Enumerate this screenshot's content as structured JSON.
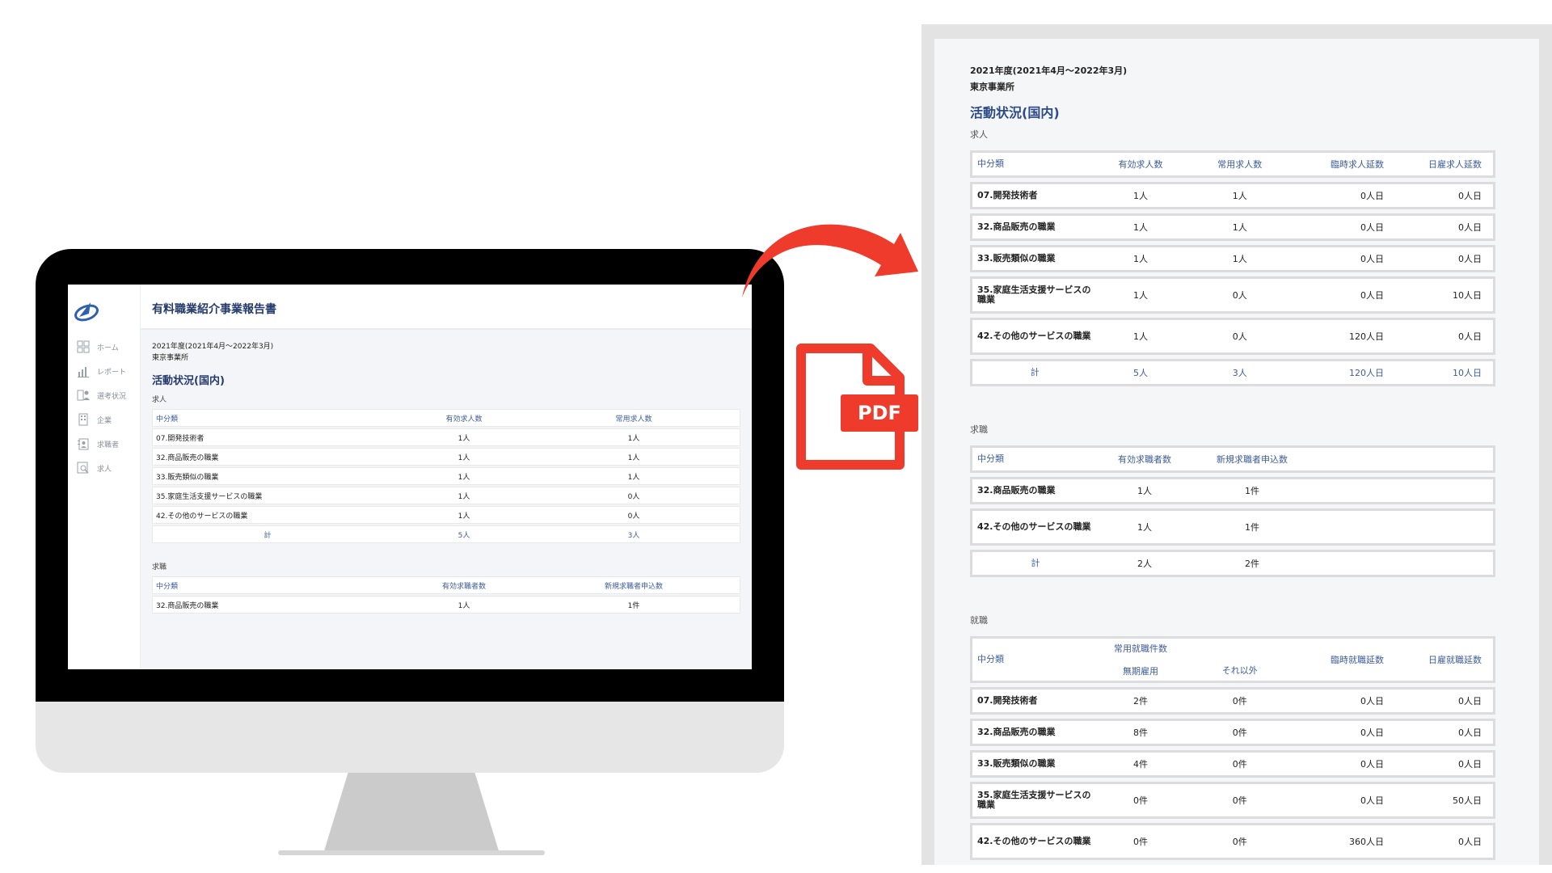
{
  "monitor": {
    "header_title": "有料職業紹介事業報告書",
    "sidebar": {
      "items": [
        {
          "label": "ホーム",
          "icon": "dashboard-icon"
        },
        {
          "label": "レポート",
          "icon": "bar-chart-icon"
        },
        {
          "label": "選考状況",
          "icon": "selection-icon"
        },
        {
          "label": "企業",
          "icon": "building-icon"
        },
        {
          "label": "求職者",
          "icon": "user-list-icon"
        },
        {
          "label": "求人",
          "icon": "job-search-icon"
        }
      ]
    },
    "period": "2021年度(2021年4月〜2022年3月)",
    "office": "東京事業所",
    "section_title": "活動状況(国内)",
    "jobs_label": "求人",
    "jobs_headers": [
      "中分類",
      "有効求人数",
      "常用求人数"
    ],
    "jobs_rows": [
      [
        "07.開発技術者",
        "1人",
        "1人"
      ],
      [
        "32.商品販売の職業",
        "1人",
        "1人"
      ],
      [
        "33.販売類似の職業",
        "1人",
        "1人"
      ],
      [
        "35.家庭生活支援サービスの職業",
        "1人",
        "0人"
      ],
      [
        "42.その他のサービスの職業",
        "1人",
        "0人"
      ]
    ],
    "jobs_total": [
      "計",
      "5人",
      "3人"
    ],
    "seekers_label": "求職",
    "seekers_headers": [
      "中分類",
      "有効求職者数",
      "新規求職者申込数"
    ],
    "seekers_rows": [
      [
        "32.商品販売の職業",
        "1人",
        "1件"
      ]
    ]
  },
  "pdf_badge": "PDF",
  "doc": {
    "period": "2021年度(2021年4月〜2022年3月)",
    "office": "東京事業所",
    "section_title": "活動状況(国内)",
    "jobs": {
      "label": "求人",
      "headers": [
        "中分類",
        "有効求人数",
        "常用求人数",
        "臨時求人延数",
        "日雇求人延数"
      ],
      "rows": [
        [
          "07.開発技術者",
          "1人",
          "1人",
          "0人日",
          "0人日"
        ],
        [
          "32.商品販売の職業",
          "1人",
          "1人",
          "0人日",
          "0人日"
        ],
        [
          "33.販売類似の職業",
          "1人",
          "1人",
          "0人日",
          "0人日"
        ],
        [
          "35.家庭生活支援サービスの職業",
          "1人",
          "0人",
          "0人日",
          "10人日"
        ],
        [
          "42.その他のサービスの職業",
          "1人",
          "0人",
          "120人日",
          "0人日"
        ]
      ],
      "total": [
        "計",
        "5人",
        "3人",
        "120人日",
        "10人日"
      ]
    },
    "seekers": {
      "label": "求職",
      "headers": [
        "中分類",
        "有効求職者数",
        "新規求職者申込数"
      ],
      "rows": [
        [
          "32.商品販売の職業",
          "1人",
          "1件"
        ],
        [
          "42.その他のサービスの職業",
          "1人",
          "1件"
        ]
      ],
      "total": [
        "計",
        "2人",
        "2件"
      ]
    },
    "placements": {
      "label": "就職",
      "headers": {
        "col1": "中分類",
        "col2_top": "常用就職件数",
        "col2_sub": "無期雇用",
        "col3_sub": "それ以外",
        "col4": "臨時就職延数",
        "col5": "日雇就職延数"
      },
      "rows": [
        [
          "07.開発技術者",
          "2件",
          "0件",
          "0人日",
          "0人日"
        ],
        [
          "32.商品販売の職業",
          "8件",
          "0件",
          "0人日",
          "0人日"
        ],
        [
          "33.販売類似の職業",
          "4件",
          "0件",
          "0人日",
          "0人日"
        ],
        [
          "35.家庭生活支援サービスの職業",
          "0件",
          "0件",
          "0人日",
          "50人日"
        ],
        [
          "42.その他のサービスの職業",
          "0件",
          "0件",
          "360人日",
          "0人日"
        ]
      ]
    }
  },
  "colors": {
    "accent": "#243a6b",
    "link": "#3d5c98",
    "arrow": "#ee3b2b"
  }
}
